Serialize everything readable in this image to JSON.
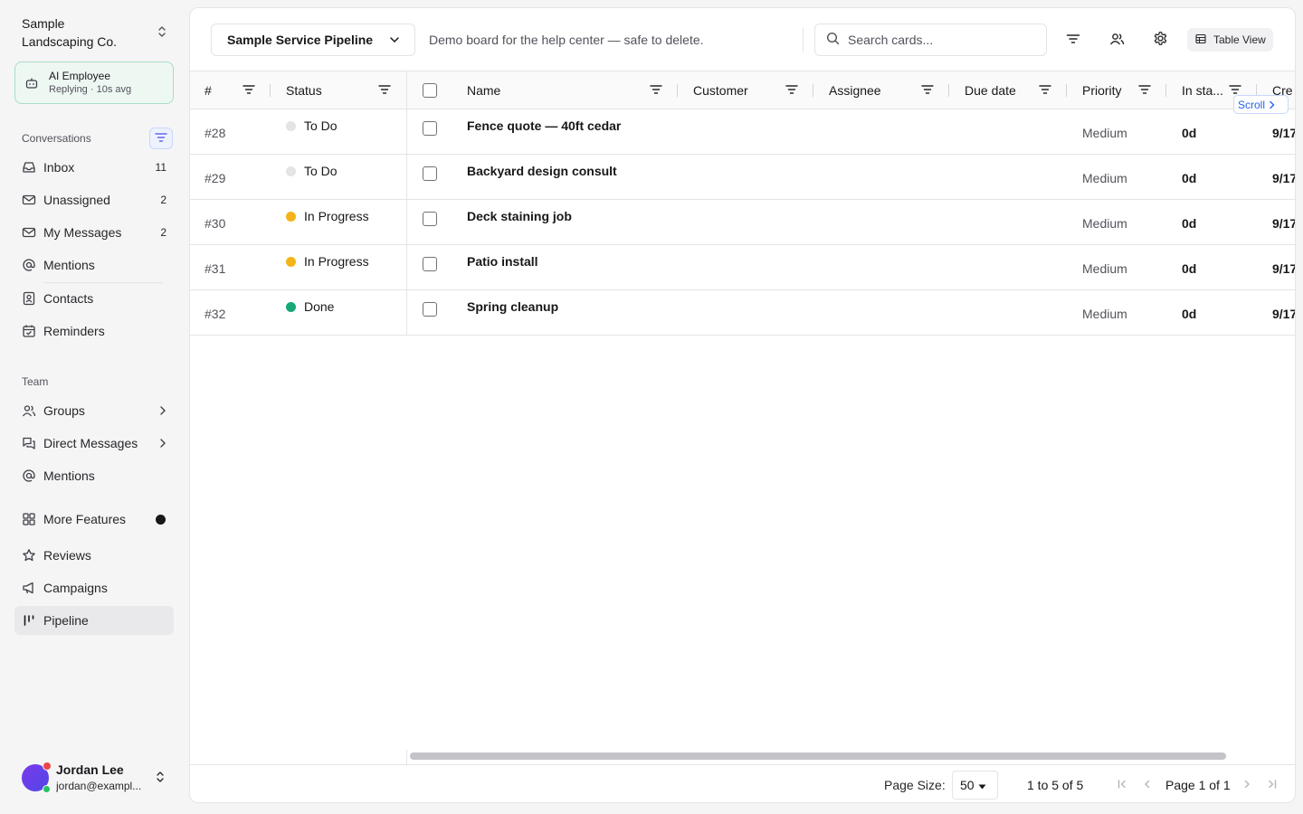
{
  "sidebar": {
    "org_name": "Sample Landscaping Co.",
    "ai_employee": {
      "title": "AI Employee",
      "subtitle": "Replying · 10s avg"
    },
    "conversations_label": "Conversations",
    "conversations": [
      {
        "label": "Inbox",
        "icon": "inbox-icon",
        "count": "11"
      },
      {
        "label": "Unassigned",
        "icon": "mail-unassigned-icon",
        "count": "2"
      },
      {
        "label": "My Messages",
        "icon": "mail-icon",
        "count": "2"
      },
      {
        "label": "Mentions",
        "icon": "at-icon",
        "count": ""
      },
      {
        "label": "Contacts",
        "icon": "contacts-icon",
        "count": ""
      },
      {
        "label": "Reminders",
        "icon": "calendar-check-icon",
        "count": ""
      }
    ],
    "team_label": "Team",
    "team": [
      {
        "label": "Groups",
        "icon": "users-icon"
      },
      {
        "label": "Direct Messages",
        "icon": "messages-icon"
      },
      {
        "label": "Mentions",
        "icon": "at-icon"
      }
    ],
    "more": [
      {
        "label": "More Features",
        "icon": "grid-icon"
      },
      {
        "label": "Reviews",
        "icon": "star-icon"
      },
      {
        "label": "Campaigns",
        "icon": "megaphone-icon"
      },
      {
        "label": "Pipeline",
        "icon": "pipeline-icon",
        "active": true
      }
    ],
    "user": {
      "name": "Jordan Lee",
      "email": "jordan@exampl..."
    }
  },
  "toolbar": {
    "pipeline": "Sample Service Pipeline",
    "description": "Demo board for the help center — safe to delete.",
    "search_placeholder": "Search cards...",
    "view_label": "Table View"
  },
  "table": {
    "columns": [
      "#",
      "Status",
      "Name",
      "Customer",
      "Assignee",
      "Due date",
      "Priority",
      "In sta...",
      "Cre"
    ],
    "rows": [
      {
        "id": "#28",
        "status": "To Do",
        "status_color": "#e4e4e7",
        "name": "Fence quote — 40ft cedar",
        "customer": "",
        "assignee": "",
        "due": "",
        "priority": "Medium",
        "in_stage": "0d",
        "created": "9/17"
      },
      {
        "id": "#29",
        "status": "To Do",
        "status_color": "#e4e4e7",
        "name": "Backyard design consult",
        "customer": "",
        "assignee": "",
        "due": "",
        "priority": "Medium",
        "in_stage": "0d",
        "created": "9/17"
      },
      {
        "id": "#30",
        "status": "In Progress",
        "status_color": "#f4b41a",
        "name": "Deck staining job",
        "customer": "",
        "assignee": "",
        "due": "",
        "priority": "Medium",
        "in_stage": "0d",
        "created": "9/17"
      },
      {
        "id": "#31",
        "status": "In Progress",
        "status_color": "#f4b41a",
        "name": "Patio install",
        "customer": "",
        "assignee": "",
        "due": "",
        "priority": "Medium",
        "in_stage": "0d",
        "created": "9/17"
      },
      {
        "id": "#32",
        "status": "Done",
        "status_color": "#16a877",
        "name": "Spring cleanup",
        "customer": "",
        "assignee": "",
        "due": "",
        "priority": "Medium",
        "in_stage": "0d",
        "created": "9/17"
      }
    ],
    "scroll_hint": "Scroll"
  },
  "footer": {
    "page_size_label": "Page Size:",
    "page_size": "50",
    "range": "1 to 5 of 5",
    "page_label": "Page 1 of 1"
  }
}
